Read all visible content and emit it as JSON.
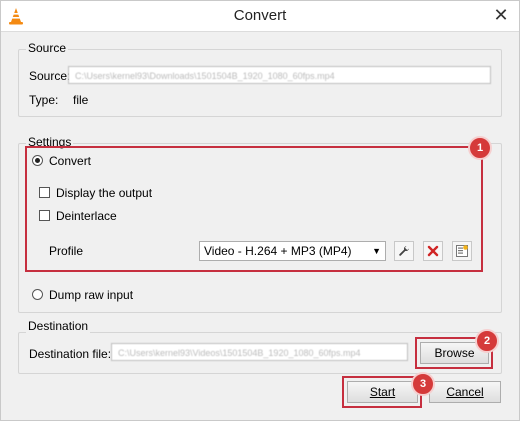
{
  "window": {
    "title": "Convert",
    "close_label": "✕"
  },
  "source": {
    "group_label": "Source",
    "source_label": "Source:",
    "source_value": "C:\\Users\\kernel93\\Downloads\\1501504B_1920_1080_60fps.mp4",
    "type_label": "Type:",
    "type_value": "file"
  },
  "settings": {
    "group_label": "Settings",
    "convert_label": "Convert",
    "display_output_label": "Display the output",
    "deinterlace_label": "Deinterlace",
    "profile_label": "Profile",
    "profile_value": "Video - H.264 + MP3 (MP4)",
    "dump_raw_label": "Dump raw input"
  },
  "destination": {
    "group_label": "Destination",
    "file_label": "Destination file:",
    "file_value": "C:\\Users\\kernel93\\Videos\\1501504B_1920_1080_60fps.mp4",
    "browse_label": "Browse"
  },
  "footer": {
    "start_label": "Start",
    "cancel_label": "Cancel"
  },
  "annotations": {
    "badge_1": "1",
    "badge_2": "2",
    "badge_3": "3"
  },
  "colors": {
    "highlight": "#c62f3f",
    "badge": "#d53a3a",
    "vlc_orange": "#f48a12"
  }
}
